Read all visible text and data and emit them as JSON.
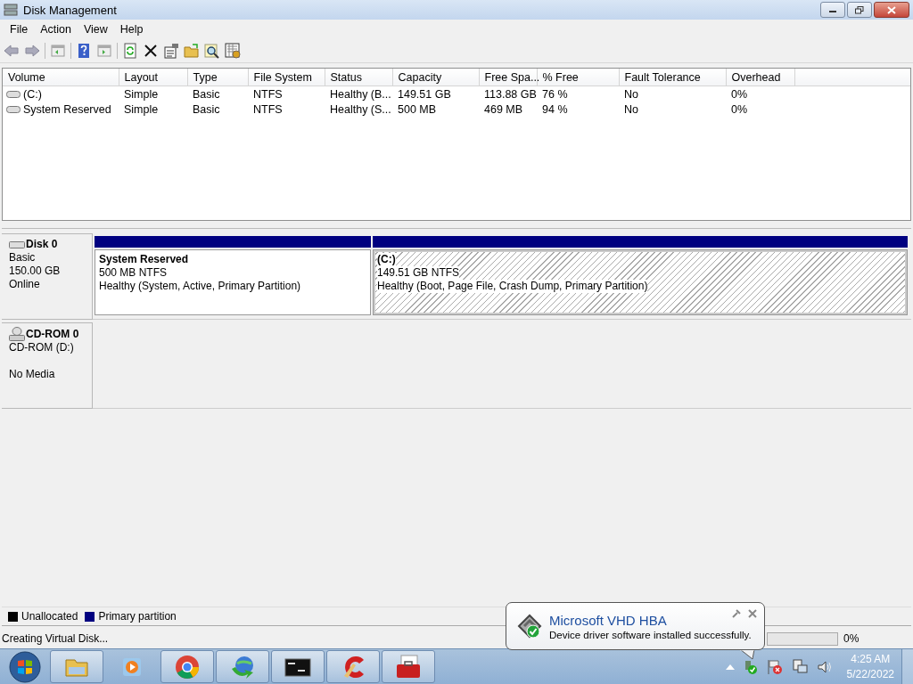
{
  "window": {
    "title": "Disk Management"
  },
  "menu": [
    "File",
    "Action",
    "View",
    "Help"
  ],
  "table": {
    "columns": [
      "Volume",
      "Layout",
      "Type",
      "File System",
      "Status",
      "Capacity",
      "Free Spa...",
      "% Free",
      "Fault Tolerance",
      "Overhead"
    ],
    "rows": [
      {
        "kind": "volume",
        "cells": [
          "(C:)",
          "Simple",
          "Basic",
          "NTFS",
          "Healthy (B...",
          "149.51 GB",
          "113.88 GB",
          "76 %",
          "No",
          "0%"
        ]
      },
      {
        "kind": "volume",
        "cells": [
          "System Reserved",
          "Simple",
          "Basic",
          "NTFS",
          "Healthy (S...",
          "500 MB",
          "469 MB",
          "94 %",
          "No",
          "0%"
        ]
      }
    ]
  },
  "disks": [
    {
      "kind": "disk",
      "name": "Disk 0",
      "lines": [
        "Basic",
        "150.00 GB",
        "Online"
      ],
      "partitions": [
        {
          "name": "System Reserved",
          "size": "500 MB NTFS",
          "status": "Healthy (System, Active, Primary Partition)",
          "selected": false
        },
        {
          "name": "(C:)",
          "size": "149.51 GB NTFS",
          "status": "Healthy (Boot, Page File, Crash Dump, Primary Partition)",
          "selected": true
        }
      ]
    },
    {
      "kind": "cdrom",
      "name": "CD-ROM 0",
      "lines": [
        "CD-ROM (D:)",
        "No Media"
      ]
    }
  ],
  "legend": [
    {
      "label": "Unallocated",
      "color": "#000000"
    },
    {
      "label": "Primary partition",
      "color": "#000080"
    }
  ],
  "status_bar": {
    "text": "Creating Virtual Disk...",
    "progress": {
      "level": 0,
      "reading": "0%"
    }
  },
  "taskbar": {
    "apps": [
      {
        "kind": "folder",
        "running": true
      },
      {
        "kind": "media",
        "running": false
      },
      {
        "kind": "chrome",
        "running": true
      },
      {
        "kind": "download",
        "running": true
      },
      {
        "kind": "console",
        "running": true
      },
      {
        "kind": "cleaner",
        "running": true
      },
      {
        "kind": "toolbox",
        "running": true
      }
    ],
    "clock": {
      "time": "4:25 AM",
      "date": "5/22/2022"
    }
  },
  "balloon": {
    "title": "Microsoft VHD HBA",
    "message": "Device driver software installed successfully."
  }
}
